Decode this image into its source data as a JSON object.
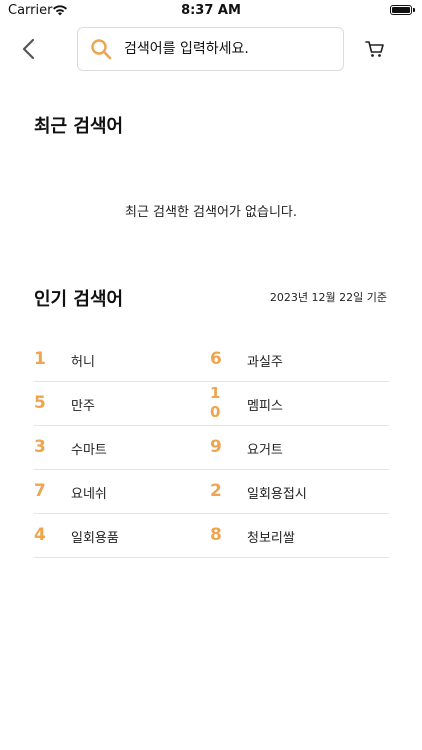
{
  "status_bar": {
    "carrier": "Carrier",
    "time": "8:37 AM"
  },
  "header": {
    "search_placeholder": "검색어를 입력하세요.",
    "back_icon": "chevron-left-icon",
    "cart_icon": "cart-icon",
    "accent_color": "#eea54d"
  },
  "recent": {
    "title": "최근 검색어",
    "empty_message": "최근 검색한 검색어가 없습니다."
  },
  "popular": {
    "title": "인기 검색어",
    "date": "2023년 12월 22일 기준",
    "rows": [
      {
        "left": {
          "rank": "1",
          "term": "허니"
        },
        "right": {
          "rank": "6",
          "term": "과실주"
        }
      },
      {
        "left": {
          "rank": "5",
          "term": "만주"
        },
        "right": {
          "rank": "10",
          "term": "멤피스"
        }
      },
      {
        "left": {
          "rank": "3",
          "term": "수마트"
        },
        "right": {
          "rank": "9",
          "term": "요거트"
        }
      },
      {
        "left": {
          "rank": "7",
          "term": "요네쉬"
        },
        "right": {
          "rank": "2",
          "term": "일회용접시"
        }
      },
      {
        "left": {
          "rank": "4",
          "term": "일회용품"
        },
        "right": {
          "rank": "8",
          "term": "청보리쌀"
        }
      }
    ]
  }
}
